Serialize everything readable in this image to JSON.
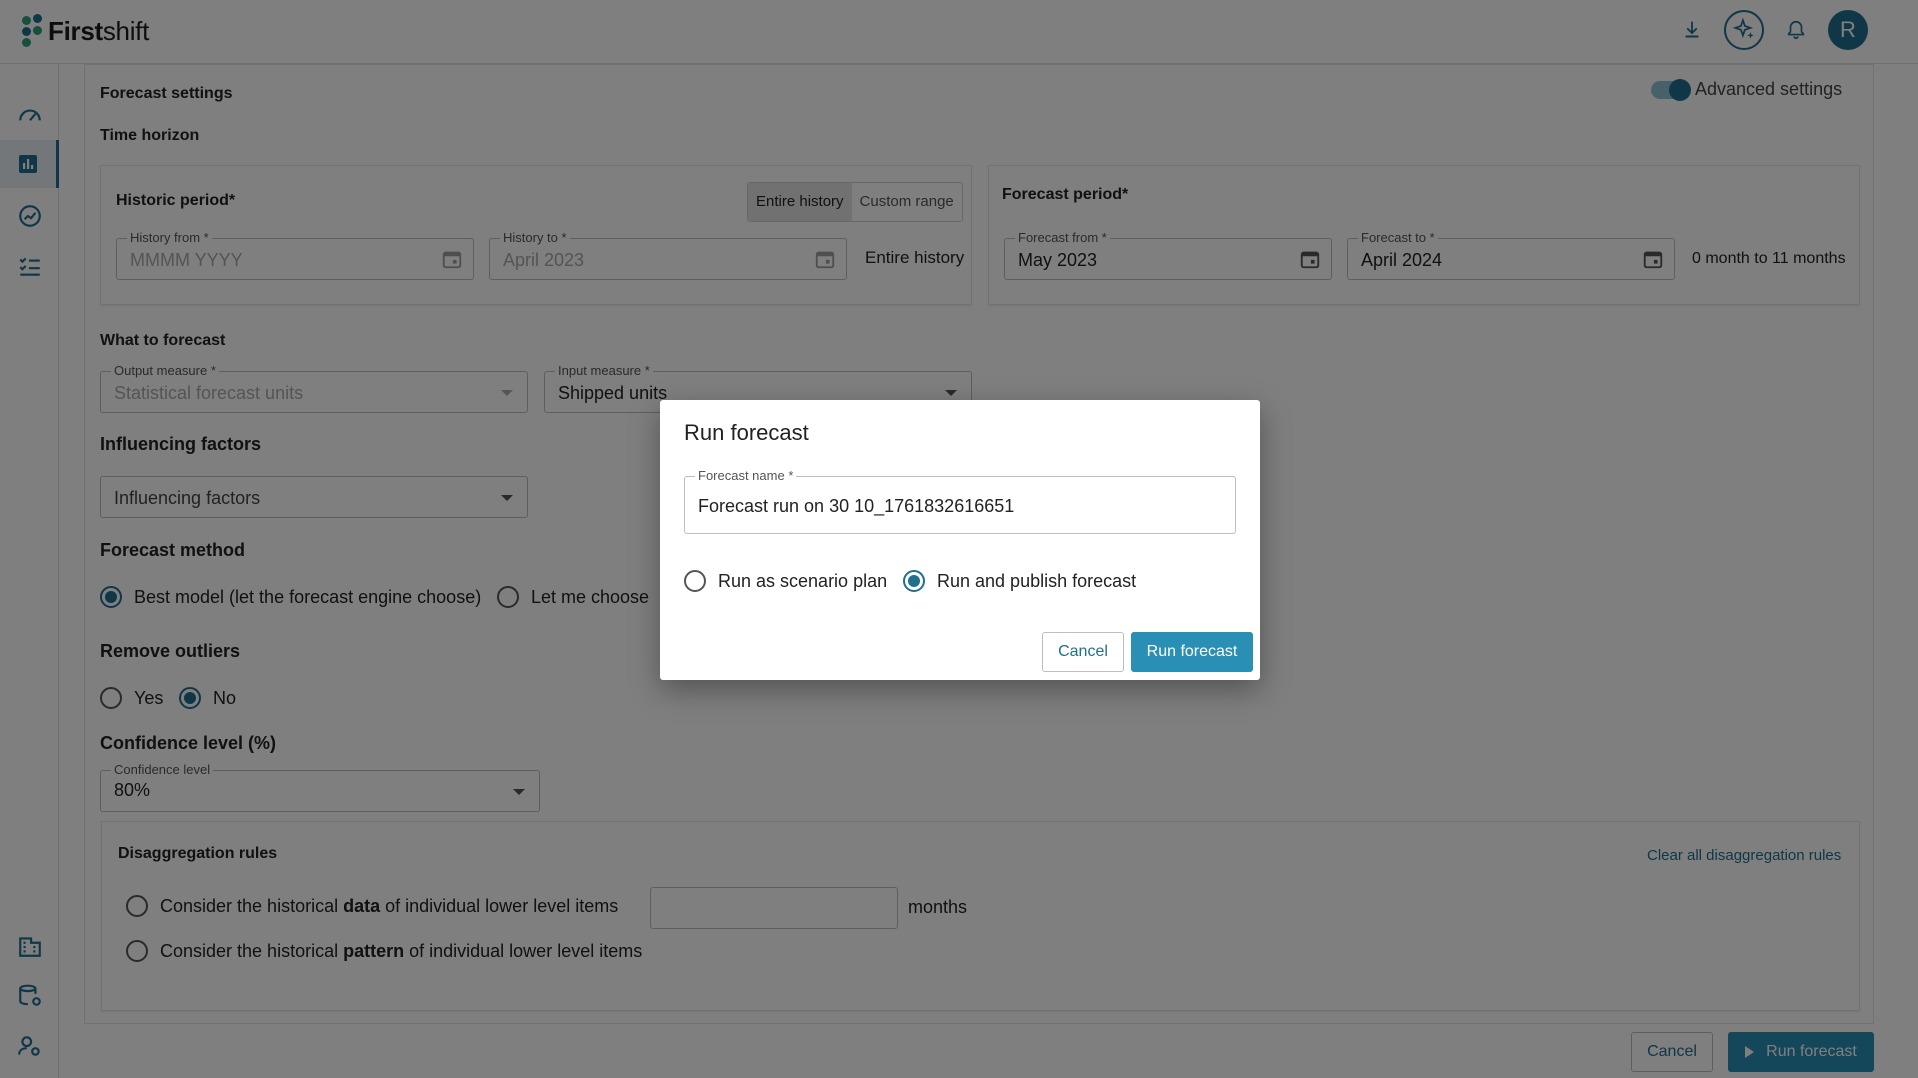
{
  "app": {
    "logo_bold": "First",
    "logo_light": "shift"
  },
  "header": {
    "avatar_initial": "R"
  },
  "settings": {
    "title": "Forecast settings",
    "advanced_label": "Advanced settings",
    "time_horizon": "Time horizon",
    "historic": {
      "title": "Historic period*",
      "seg_entire": "Entire history",
      "seg_custom": "Custom range",
      "from_label": "History from *",
      "from_placeholder": "MMMM YYYY",
      "to_label": "History to *",
      "to_value": "April 2023",
      "summary": "Entire history"
    },
    "forecast_period": {
      "title": "Forecast period*",
      "from_label": "Forecast from *",
      "from_value": "May 2023",
      "to_label": "Forecast to *",
      "to_value": "April 2024",
      "summary": "0 month to 11 months"
    },
    "what": {
      "title": "What to forecast",
      "output_label": "Output measure *",
      "output_value": "Statistical forecast units",
      "input_label": "Input measure *",
      "input_value": "Shipped units"
    },
    "influencing": {
      "title": "Influencing factors",
      "placeholder": "Influencing factors"
    },
    "method": {
      "title": "Forecast method",
      "best": "Best model (let the forecast engine choose)",
      "choose": "Let me choose"
    },
    "outliers": {
      "title": "Remove outliers",
      "yes": "Yes",
      "no": "No"
    },
    "confidence": {
      "title": "Confidence level (%)",
      "label": "Confidence level",
      "value": "80%"
    },
    "disagg": {
      "title": "Disaggregation rules",
      "clear": "Clear all disaggregation rules",
      "rule1_pre": "Consider the historical ",
      "rule1_bold": "data",
      "rule1_post": " of individual lower level items",
      "rule1_unit": "months",
      "rule2_pre": "Consider the historical ",
      "rule2_bold": "pattern",
      "rule2_post": " of individual lower level items"
    }
  },
  "footer": {
    "cancel": "Cancel",
    "run": "Run forecast"
  },
  "dialog": {
    "title": "Run forecast",
    "name_label": "Forecast name *",
    "name_value": "Forecast run on 30 10_1761832616651",
    "opt_scenario": "Run as scenario plan",
    "opt_publish": "Run and publish forecast",
    "cancel": "Cancel",
    "run": "Run forecast"
  },
  "colors": {
    "accent": "#1f6f8f",
    "primary_button": "#2a8fb5"
  }
}
